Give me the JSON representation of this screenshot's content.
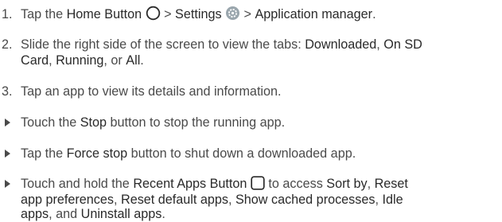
{
  "steps": [
    {
      "num": "1.",
      "t1": "Tap the ",
      "b1": "Home Button",
      "t2": " > ",
      "b2": "Settings",
      "t3": " > ",
      "b3": "Application manager",
      "t4": "."
    },
    {
      "num": "2.",
      "t1": "Slide the right side of the screen to view the tabs: ",
      "b1": "Downloaded",
      "t2": ", ",
      "b2a": "On SD",
      "b2b": "Card",
      "t3": ", ",
      "b3": "Running",
      "t4": ", or ",
      "b4": "All",
      "t5": "."
    },
    {
      "num": "3.",
      "t1": "Tap an app to view its details and information."
    }
  ],
  "bullets": [
    {
      "t1": "Touch the ",
      "b1": "Stop",
      "t2": " button to stop the running app."
    },
    {
      "t1": "Tap the ",
      "b1": "Force stop",
      "t2": " button to shut down a downloaded app."
    },
    {
      "t1": "Touch and hold the ",
      "b1": "Recent Apps Button",
      "t2": " to access ",
      "b2": "Sort by",
      "t3": ", ",
      "b3a": "Reset",
      "b3b": "app preferences",
      "t4": ", ",
      "b4": "Reset default apps",
      "t5": ", ",
      "b5": "Show cached processes",
      "t6": ", ",
      "b6a": "Idle",
      "b6b": "apps",
      "t7": ", and ",
      "b7": "Uninstall apps",
      "t8": "."
    }
  ],
  "icons": {
    "home_button": "circle-outline-icon",
    "settings": "settings-gear-icon",
    "recent_apps_button": "rounded-square-outline-icon"
  },
  "colors": {
    "text": "#4a4a4a",
    "settings_icon": "#9aa6ad"
  }
}
